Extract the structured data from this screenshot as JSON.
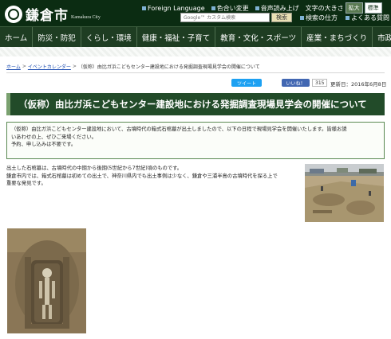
{
  "header": {
    "city_name": "鎌倉市",
    "city_name_en": "Kamakura City",
    "foreign_language": "Foreign Language",
    "color_change": "色合い変更",
    "read_aloud": "音声読み上げ",
    "text_size_label": "文字の大きさ",
    "text_size_large": "拡大",
    "text_size_standard": "標準",
    "search_placeholder": "Google™ カスタム検索",
    "search_button": "検索",
    "search_howto": "検索の仕方",
    "faq": "よくある質問"
  },
  "nav": {
    "items": [
      {
        "label": "ホーム"
      },
      {
        "label": "防災・防犯"
      },
      {
        "label": "くらし・環境"
      },
      {
        "label": "健康・福祉・子育て"
      },
      {
        "label": "教育・文化・スポーツ"
      },
      {
        "label": "産業・まちづくり"
      },
      {
        "label": "市政情報"
      }
    ]
  },
  "breadcrumb": {
    "home": "ホーム",
    "event_calendar": "イベントカレンダー",
    "current": "（仮称）由比ガ浜こどもセンター建設地における発掘調査現場見学会の開催について",
    "separator": ">"
  },
  "social": {
    "tweet": "ツイート",
    "like": "いいね！",
    "like_count": "315"
  },
  "updated": "更新日：2016年6月8日",
  "title": "（仮称）由比ガ浜こどもセンター建設地における発掘調査現場見学会の開催について",
  "notice": {
    "line1": "（仮称）由比ガ浜こどもセンター建設地において、古墳時代の箱式石棺墓が出土しましたので、以下の日程で現場見学会を開催いたします。皆様お誘",
    "line2": "いあわせの上、ぜひご来場ください。",
    "line3": "予約、申し込みは不要です。"
  },
  "body": {
    "line1": "出土した石棺墓は、古墳時代の中期から後期(5世紀から7世紀)頃のものです。",
    "line2": "鎌倉市内では、箱式石棺墓は初めての出土で、神奈川県内でも出土事例は少なく、鎌倉や三浦半島の古墳時代を探る上で",
    "line3": "重要な発見です。"
  }
}
